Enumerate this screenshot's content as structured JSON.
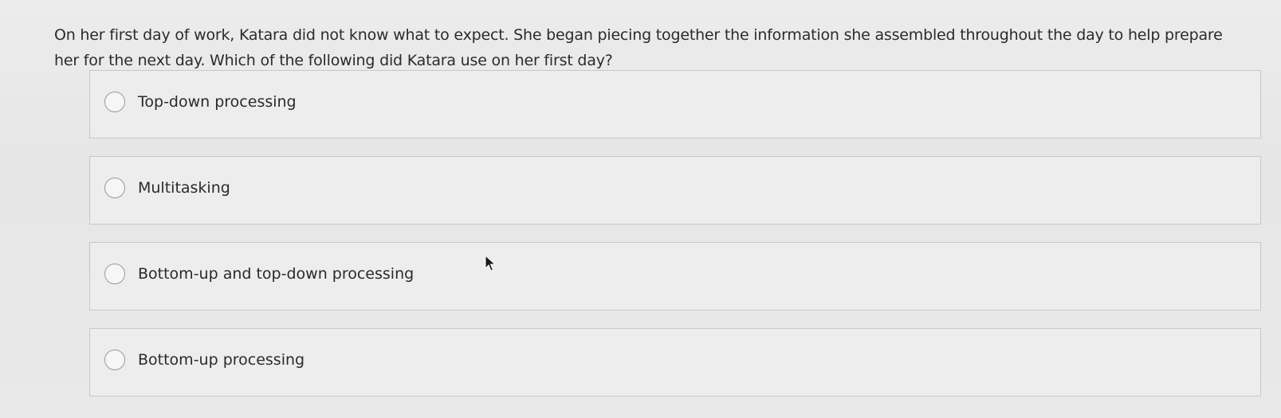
{
  "question": {
    "text": "On her first day of work, Katara did not know what to expect. She began piecing together the information she assembled throughout the day to help prepare her for the next day. Which of the following did Katara use on her first day?"
  },
  "options": [
    {
      "label": "Top-down processing"
    },
    {
      "label": "Multitasking"
    },
    {
      "label": "Bottom-up and top-down processing"
    },
    {
      "label": "Bottom-up processing"
    }
  ],
  "cursor": {
    "icon": "mouse-pointer-icon"
  }
}
